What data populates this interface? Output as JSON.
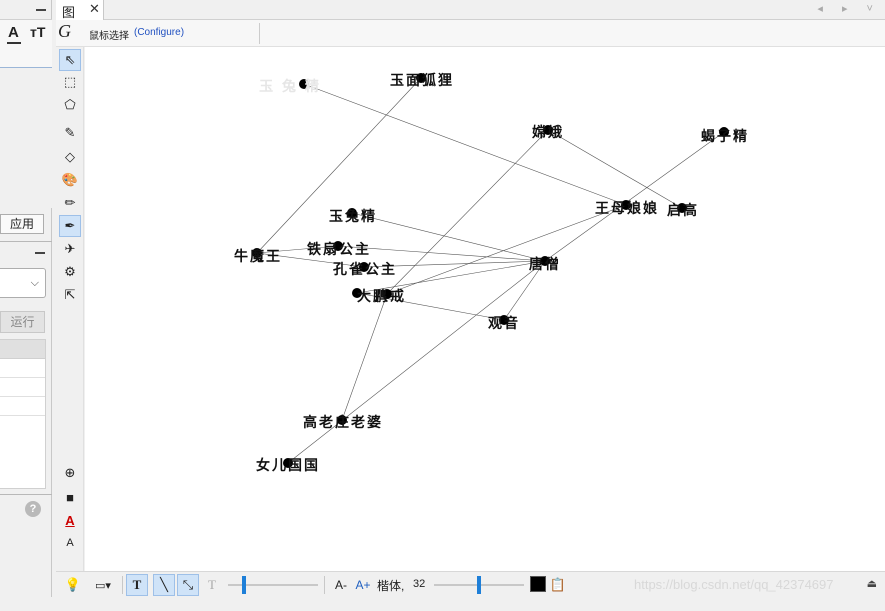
{
  "left_panel": {
    "format_a_label": "A",
    "format_tt_label": "тT",
    "apply_label": "应用",
    "run_label": "运行",
    "select_chevron": "⌵",
    "help_label": "?"
  },
  "tabs": [
    {
      "label": "图",
      "close": "✕"
    }
  ],
  "nav_arrows": "◂ ▸ ˅",
  "graphics_toolbar": {
    "logo": "G",
    "mode_label": "鼠标选择",
    "configure_label": "(Configure)"
  },
  "tools": [
    {
      "name": "move-tool-icon",
      "glyph": "⇖",
      "active": true
    },
    {
      "name": "select-rectangle-icon",
      "glyph": "⬚",
      "active": false
    },
    {
      "name": "polygon-icon",
      "glyph": "⬠",
      "active": false
    },
    {
      "name": "pen-icon",
      "glyph": "✎",
      "active": false
    },
    {
      "name": "diamond-icon",
      "glyph": "◇",
      "active": false
    },
    {
      "name": "palette-icon",
      "glyph": "🎨",
      "active": false
    },
    {
      "name": "pencil-icon",
      "glyph": "✏",
      "active": false
    },
    {
      "name": "edge-draw-icon",
      "glyph": "✒",
      "active": true
    },
    {
      "name": "airplane-icon",
      "glyph": "✈",
      "active": false
    },
    {
      "name": "gear-icon",
      "glyph": "⚙",
      "active": false
    },
    {
      "name": "help-cursor-icon",
      "glyph": "⇱",
      "active": false
    }
  ],
  "bottom_tools": [
    {
      "name": "zoom-icon",
      "glyph": "⊕"
    },
    {
      "name": "fill-square-icon",
      "glyph": "■"
    },
    {
      "name": "text-color-icon",
      "glyph": "A"
    },
    {
      "name": "text-small-icon",
      "glyph": "A"
    }
  ],
  "bottom_toolbar": {
    "bulb": "💡",
    "font_decrease": "A-",
    "font_increase": "A+",
    "font_name": "楷体,",
    "font_size": "32",
    "watermark": "https://blog.csdn.net/qq_42374697",
    "collapse": "⏏"
  },
  "graph": {
    "nodes": [
      {
        "id": "yuhou",
        "label": "玉 兔 精",
        "faded": true
      },
      {
        "id": "yumian",
        "label": "玉面狐狸",
        "faded": false
      },
      {
        "id": "change",
        "label": "嫦娥",
        "faded": false
      },
      {
        "id": "xiezi",
        "label": "蝎子精",
        "faded": false
      },
      {
        "id": "wangmu",
        "label": "王母娘娘",
        "faded": false
      },
      {
        "id": "qigao",
        "label": "启高",
        "faded": false
      },
      {
        "id": "yutu",
        "label": "玉兔精",
        "faded": false
      },
      {
        "id": "niumo",
        "label": "牛魔王",
        "faded": false
      },
      {
        "id": "tieshan",
        "label": "铁扇公主",
        "faded": false
      },
      {
        "id": "kongque",
        "label": "孔雀公主",
        "faded": false
      },
      {
        "id": "tangseng",
        "label": "唐僧",
        "faded": false
      },
      {
        "id": "dapeng",
        "label": "大鹏",
        "faded": false
      },
      {
        "id": "bajie",
        "label": "八戒",
        "faded": false
      },
      {
        "id": "guanyin",
        "label": "观音",
        "faded": false
      },
      {
        "id": "gaolao",
        "label": "高老庄老婆",
        "faded": false
      },
      {
        "id": "nver",
        "label": "女儿国国",
        "faded": false
      }
    ],
    "edges": [
      [
        "yuhou",
        "wangmu"
      ],
      [
        "yumian",
        "niumo"
      ],
      [
        "change",
        "qigao"
      ],
      [
        "change",
        "bajie"
      ],
      [
        "xiezi",
        "tangseng"
      ],
      [
        "wangmu",
        "bajie"
      ],
      [
        "yutu",
        "tangseng"
      ],
      [
        "niumo",
        "tieshan"
      ],
      [
        "niumo",
        "kongque"
      ],
      [
        "kongque",
        "tangseng"
      ],
      [
        "dapeng",
        "tangseng"
      ],
      [
        "dapeng",
        "guanyin"
      ],
      [
        "bajie",
        "gaolao"
      ],
      [
        "tangseng",
        "nver"
      ],
      [
        "tangseng",
        "guanyin"
      ],
      [
        "tieshan",
        "tangseng"
      ]
    ]
  }
}
